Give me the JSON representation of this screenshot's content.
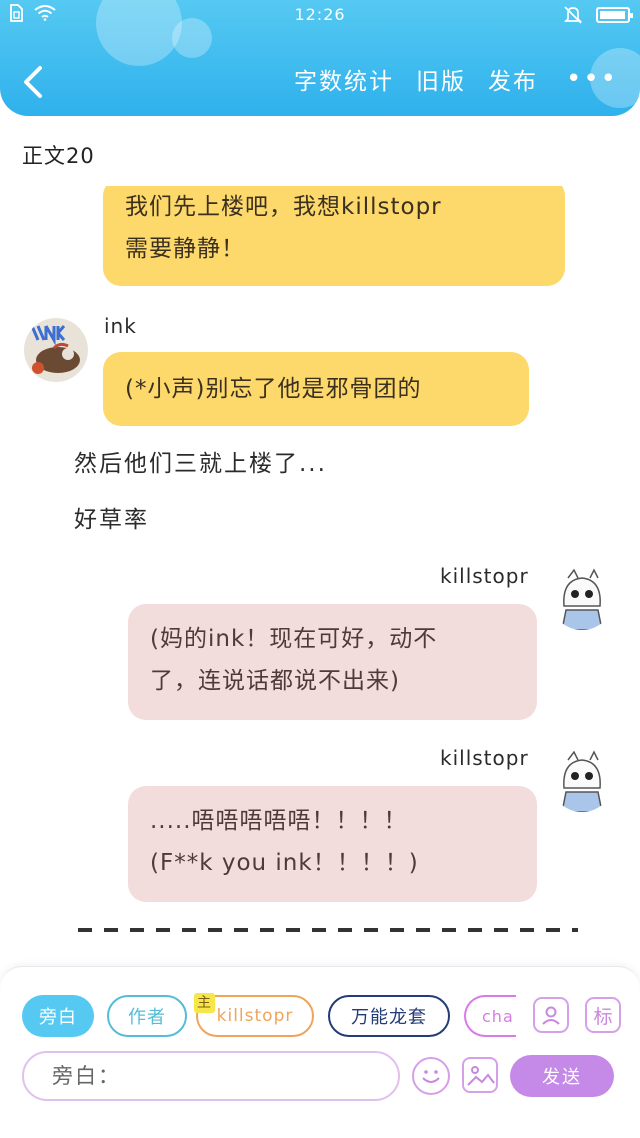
{
  "status": {
    "time": "12:26",
    "battery_level": 0.95
  },
  "header": {
    "actions": [
      "字数统计",
      "旧版",
      "发布"
    ],
    "more": "•••"
  },
  "section": {
    "title": "正文20"
  },
  "messages": {
    "m1": {
      "lines": [
        "我们先上楼吧，我想killstopr",
        "需要静静！"
      ]
    },
    "m2": {
      "name": "ink",
      "lines": [
        "(*小声)别忘了他是邪骨团的"
      ]
    },
    "n1": "然后他们三就上楼了...",
    "n2": "好草率",
    "m3": {
      "name": "killstopr",
      "lines": [
        "(妈的ink！现在可好，动不",
        "了，连说话都说不出来)"
      ]
    },
    "m4": {
      "name": "killstopr",
      "lines": [
        ".....唔唔唔唔唔！！！！",
        "(F**k you ink！！！！)"
      ]
    }
  },
  "composer": {
    "chips": {
      "narration": "旁白",
      "author": "作者",
      "kill_tag": "主",
      "kill": "killstopr",
      "wan": "万能龙套",
      "cha": "cha"
    },
    "role_btn": "标",
    "input_placeholder": "旁白：",
    "send": "发送"
  },
  "colors": {
    "header": "#2fb1ec",
    "bubble_left": "#fcd96a",
    "bubble_right": "#f2dcdc",
    "send": "#c58ae8"
  }
}
